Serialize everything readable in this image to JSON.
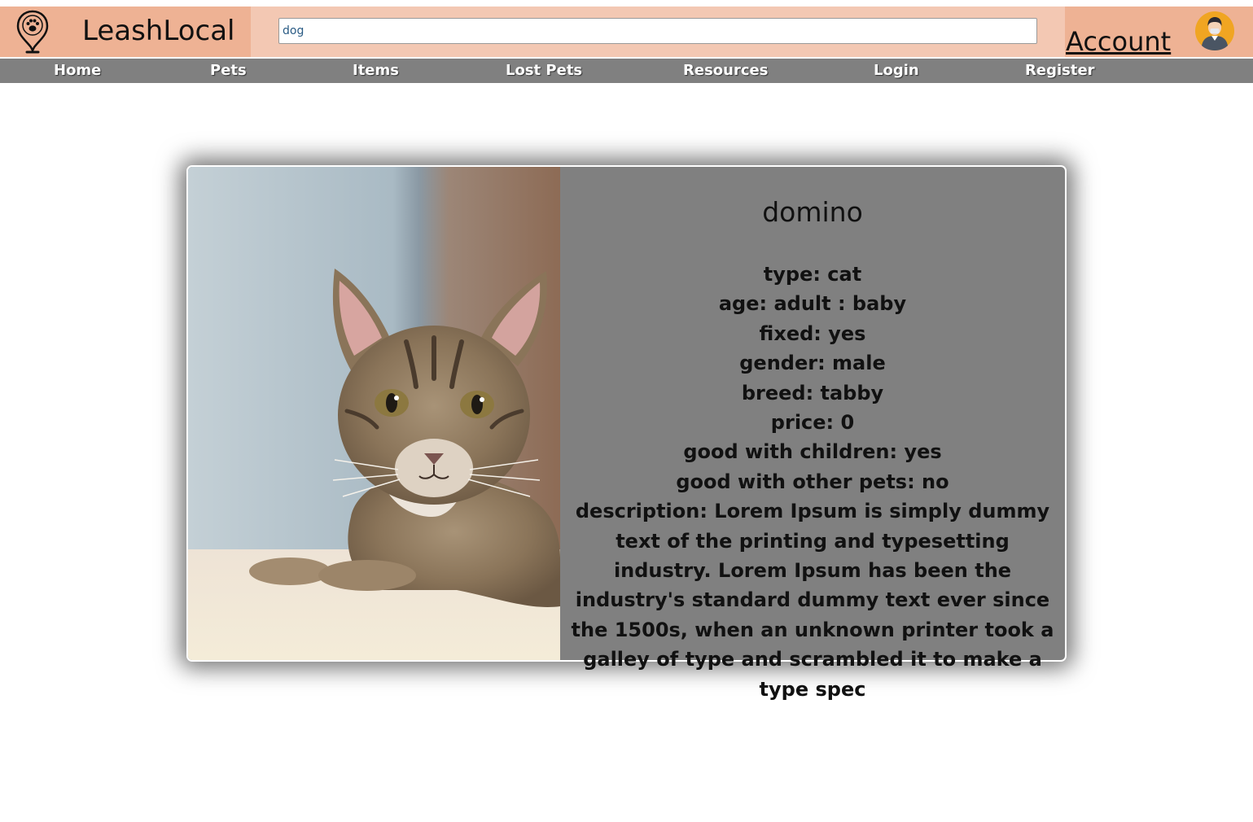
{
  "header": {
    "brand": "LeashLocal",
    "search": {
      "value": "dog",
      "placeholder": ""
    },
    "account_label": "Account",
    "logo_icon": "paw-location-pin-icon",
    "avatar_icon": "user-avatar-icon"
  },
  "nav": {
    "items": [
      {
        "label": "Home"
      },
      {
        "label": "Pets"
      },
      {
        "label": "Items"
      },
      {
        "label": "Lost Pets"
      },
      {
        "label": "Resources"
      },
      {
        "label": "Login"
      },
      {
        "label": "Register"
      }
    ]
  },
  "pet": {
    "name": "domino",
    "photo_icon": "tabby-cat-photo",
    "type": "type: cat",
    "age": "age: adult : baby",
    "fixed": "fixed: yes",
    "gender": "gender: male",
    "breed": "breed: tabby",
    "price": "price: 0",
    "good_with_children": "good with children: yes",
    "good_with_other_pets": "good with other pets: no",
    "description": "description: Lorem Ipsum is simply dummy text of the printing and typesetting industry. Lorem Ipsum has been the industry's standard dummy text ever since the 1500s, when an unknown printer took a galley of type and scrambled it to make a type spec"
  },
  "colors": {
    "header_bg": "#f3c8b3",
    "brand_bg": "#eeb294",
    "nav_bg": "#808080",
    "card_bg": "#808080"
  }
}
